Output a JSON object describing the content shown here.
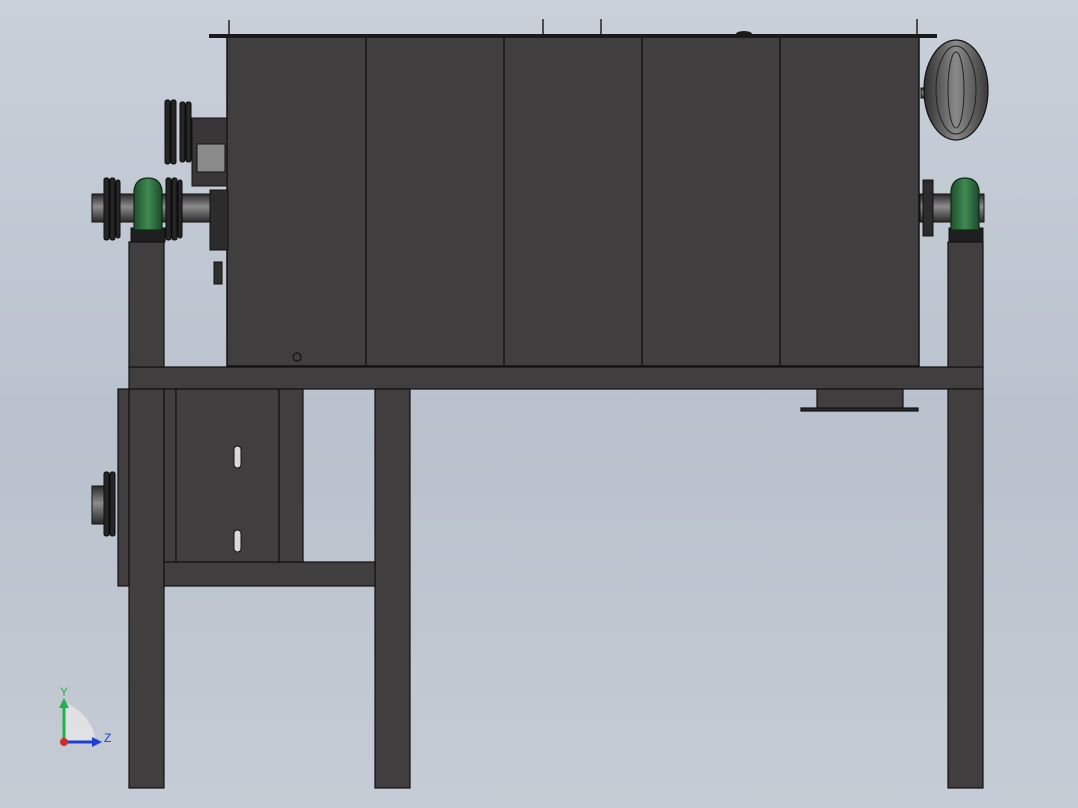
{
  "viewport": {
    "background_top": "#c9d0da",
    "background_bottom": "#c6ccd5"
  },
  "model": {
    "body_color": "#3f3d3d",
    "edge_color": "#111111",
    "motor_color": "#2d6b3d",
    "sprocket_color": "#2b2b2b",
    "fan_color": "#4a4a4a"
  },
  "triad": {
    "y_label": "Y",
    "z_label": "Z",
    "y_color": "#22b14c",
    "z_color": "#1f3fd1",
    "x_color": "#d62b2b"
  }
}
